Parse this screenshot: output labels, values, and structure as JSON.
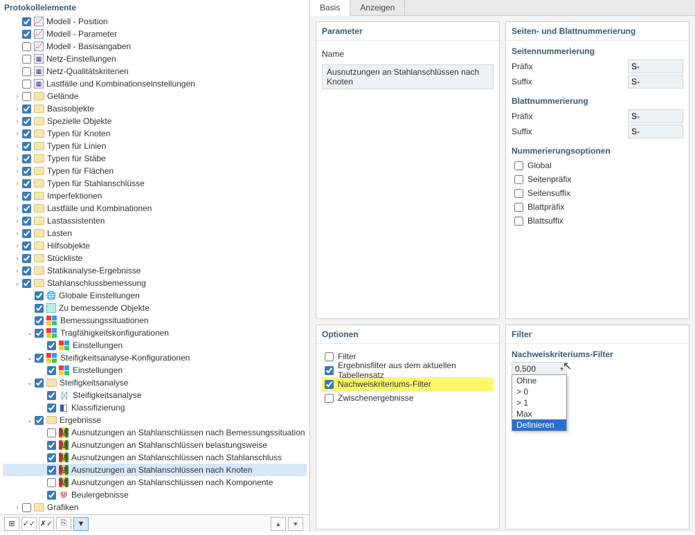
{
  "left": {
    "header": "Protokollelemente",
    "tree": [
      {
        "d": 0,
        "exp": "",
        "cb": true,
        "ico": "chart",
        "label": "Modell - Position"
      },
      {
        "d": 0,
        "exp": "",
        "cb": true,
        "ico": "chart",
        "label": "Modell - Parameter"
      },
      {
        "d": 0,
        "exp": "",
        "cb": false,
        "ico": "chart",
        "label": "Modell - Basisangaben"
      },
      {
        "d": 0,
        "exp": "",
        "cb": false,
        "ico": "mesh",
        "label": "Netz-Einstellungen"
      },
      {
        "d": 0,
        "exp": "",
        "cb": false,
        "ico": "mesh",
        "label": "Netz-Qualitätskriterien"
      },
      {
        "d": 0,
        "exp": "",
        "cb": false,
        "ico": "mesh",
        "label": "Lastfälle und Kombinationseinstellungen"
      },
      {
        "d": 0,
        "exp": ">",
        "cb": false,
        "ico": "folder",
        "label": "Gelände"
      },
      {
        "d": 0,
        "exp": ">",
        "cb": true,
        "ico": "folder",
        "label": "Basisobjekte"
      },
      {
        "d": 0,
        "exp": ">",
        "cb": true,
        "ico": "folder",
        "label": "Spezielle Objekte"
      },
      {
        "d": 0,
        "exp": ">",
        "cb": true,
        "ico": "folder",
        "label": "Typen für Knoten"
      },
      {
        "d": 0,
        "exp": ">",
        "cb": true,
        "ico": "folder",
        "label": "Typen für Linien"
      },
      {
        "d": 0,
        "exp": ">",
        "cb": true,
        "ico": "folder",
        "label": "Typen für Stäbe"
      },
      {
        "d": 0,
        "exp": ">",
        "cb": true,
        "ico": "folder",
        "label": "Typen für Flächen"
      },
      {
        "d": 0,
        "exp": ">",
        "cb": true,
        "ico": "folder",
        "label": "Typen für Stahlanschlüsse"
      },
      {
        "d": 0,
        "exp": ">",
        "cb": true,
        "ico": "folder",
        "label": "Imperfektionen"
      },
      {
        "d": 0,
        "exp": ">",
        "cb": true,
        "ico": "folder",
        "label": "Lastfälle und Kombinationen"
      },
      {
        "d": 0,
        "exp": ">",
        "cb": true,
        "ico": "folder",
        "label": "Lastassistenten"
      },
      {
        "d": 0,
        "exp": ">",
        "cb": true,
        "ico": "folder",
        "label": "Lasten"
      },
      {
        "d": 0,
        "exp": ">",
        "cb": true,
        "ico": "folder",
        "label": "Hilfsobjekte"
      },
      {
        "d": 0,
        "exp": ">",
        "cb": true,
        "ico": "folder",
        "label": "Stückliste"
      },
      {
        "d": 0,
        "exp": ">",
        "cb": true,
        "ico": "folder",
        "label": "Statikanalyse-Ergebnisse"
      },
      {
        "d": 0,
        "exp": "v",
        "cb": true,
        "ico": "folder",
        "label": "Stahlanschlussbemessung"
      },
      {
        "d": 1,
        "exp": "",
        "cb": true,
        "ico": "globe",
        "label": "Globale Einstellungen"
      },
      {
        "d": 1,
        "exp": "",
        "cb": true,
        "ico": "cyan",
        "label": "Zu bemessende Objekte"
      },
      {
        "d": 1,
        "exp": "",
        "cb": true,
        "ico": "cfg",
        "label": "Bemessungssituationen"
      },
      {
        "d": 1,
        "exp": "v",
        "cb": true,
        "ico": "cfg",
        "label": "Tragfähigkeitskonfigurationen"
      },
      {
        "d": 2,
        "exp": "",
        "cb": true,
        "ico": "cfg",
        "label": "Einstellungen"
      },
      {
        "d": 1,
        "exp": "v",
        "cb": true,
        "ico": "cfg",
        "label": "Steifigkeitsanalyse-Konfigurationen"
      },
      {
        "d": 2,
        "exp": "",
        "cb": true,
        "ico": "cfg",
        "label": "Einstellungen"
      },
      {
        "d": 1,
        "exp": "v",
        "cb": true,
        "ico": "folder",
        "label": "Steifigkeitsanalyse"
      },
      {
        "d": 2,
        "exp": "",
        "cb": true,
        "ico": "stiff",
        "label": "Steifigkeitsanalyse"
      },
      {
        "d": 2,
        "exp": "",
        "cb": true,
        "ico": "klass",
        "label": "Klassifizierung"
      },
      {
        "d": 1,
        "exp": "v",
        "cb": true,
        "ico": "folder",
        "label": "Ergebnisse"
      },
      {
        "d": 2,
        "exp": "",
        "cb": false,
        "ico": "util multi",
        "label": "Ausnutzungen an Stahlanschlüssen nach Bemessungssituation"
      },
      {
        "d": 2,
        "exp": "",
        "cb": true,
        "ico": "util multi",
        "label": "Ausnutzungen an Stahlanschlüssen belastungsweise"
      },
      {
        "d": 2,
        "exp": "",
        "cb": true,
        "ico": "util multi",
        "label": "Ausnutzungen an Stahlanschlüssen nach Stahlanschluss"
      },
      {
        "d": 2,
        "exp": "",
        "cb": true,
        "ico": "util multi",
        "label": "Ausnutzungen an Stahlanschlüssen nach Knoten",
        "sel": true
      },
      {
        "d": 2,
        "exp": "",
        "cb": false,
        "ico": "util multi",
        "label": "Ausnutzungen an Stahlanschlüssen nach Komponente"
      },
      {
        "d": 2,
        "exp": "",
        "cb": true,
        "ico": "util red",
        "label": "Beulergebnisse"
      },
      {
        "d": 0,
        "exp": ">",
        "cb": false,
        "ico": "folder",
        "label": "Grafiken"
      }
    ]
  },
  "right": {
    "tabs": {
      "basis": "Basis",
      "anzeigen": "Anzeigen"
    },
    "parameter": {
      "title": "Parameter",
      "name_label": "Name",
      "name_value": "Ausnutzungen an Stahlanschlüssen nach Knoten"
    },
    "numbering": {
      "title": "Seiten- und Blattnummerierung",
      "page_title": "Seitennummerierung",
      "sheet_title": "Blattnummerierung",
      "prefix_label": "Präfix",
      "suffix_label": "Suffix",
      "page_prefix": "S-",
      "page_suffix": "S-",
      "sheet_prefix": "S-",
      "sheet_suffix": "S-",
      "options_title": "Nummerierungsoptionen",
      "opts": [
        "Global",
        "Seitenpräfix",
        "Seitensuffix",
        "Blattpräfix",
        "Blattsuffix"
      ]
    },
    "options": {
      "title": "Optionen",
      "items": [
        {
          "checked": false,
          "hl": false,
          "label": "Filter"
        },
        {
          "checked": true,
          "hl": false,
          "label": "Ergebnisfilter aus dem aktuellen Tabellensatz"
        },
        {
          "checked": true,
          "hl": true,
          "label": "Nachweiskriteriums-Filter"
        },
        {
          "checked": false,
          "hl": false,
          "label": "Zwischenergebnisse"
        }
      ]
    },
    "filter": {
      "title": "Filter",
      "crit_label": "Nachweiskriteriums-Filter",
      "dd_value": "0.500",
      "dd_items": [
        "Ohne",
        "> 0",
        "> 1",
        "Max",
        "Definieren"
      ],
      "dd_selected": "Definieren"
    }
  }
}
